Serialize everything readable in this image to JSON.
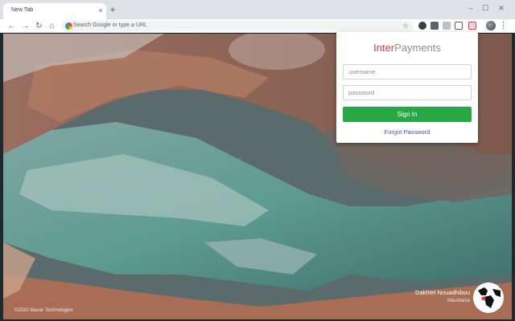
{
  "browser": {
    "tab_title": "New Tab",
    "tab_close_glyph": "×",
    "new_tab_glyph": "+",
    "omnibox_placeholder": "Search Google or type a URL",
    "icons": [
      "back-arrow-icon",
      "forward-arrow-icon",
      "reload-icon",
      "home-icon",
      "star-icon",
      "menu-dots-icon"
    ],
    "window_controls": {
      "minimize": "–",
      "maximize": "☐",
      "close": "✕"
    }
  },
  "background": {
    "credit": "©2020 Maxar Technologies",
    "place_name": "Dakhlet Nouadhibou",
    "country": "Mauritania"
  },
  "popup": {
    "logo_part1": "Inter",
    "logo_part2": "Payments",
    "username_placeholder": "username",
    "password_placeholder": "password",
    "signin_label": "Sign In",
    "forgot_label": "Forgot Password",
    "colors": {
      "brand_red": "#e23b3b",
      "signin_green": "#28a745",
      "link_blue": "#4a4fc7"
    }
  }
}
